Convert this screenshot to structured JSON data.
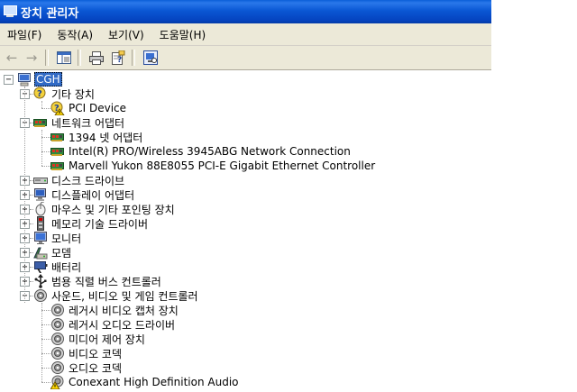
{
  "window": {
    "title": "장치 관리자"
  },
  "menu": [
    "파일(F)",
    "동작(A)",
    "보기(V)",
    "도움말(H)"
  ],
  "tree": {
    "root": "CGH",
    "categories": [
      {
        "label": "기타 장치",
        "icon": "unknown-device-icon",
        "expanded": true,
        "children": [
          {
            "label": "PCI Device",
            "icon": "warning-device-icon"
          }
        ]
      },
      {
        "label": "네트워크 어댑터",
        "icon": "network-adapter-icon",
        "expanded": true,
        "children": [
          {
            "label": "1394 넷 어댑터",
            "icon": "network-adapter-icon"
          },
          {
            "label": "Intel(R) PRO/Wireless 3945ABG Network Connection",
            "icon": "network-adapter-icon"
          },
          {
            "label": "Marvell Yukon 88E8055 PCI-E Gigabit Ethernet Controller",
            "icon": "network-adapter-icon"
          }
        ]
      },
      {
        "label": "디스크 드라이브",
        "icon": "disk-drive-icon",
        "expanded": false
      },
      {
        "label": "디스플레이 어댑터",
        "icon": "display-adapter-icon",
        "expanded": false
      },
      {
        "label": "마우스 및 기타 포인팅 장치",
        "icon": "mouse-icon",
        "expanded": false
      },
      {
        "label": "메모리 기술 드라이버",
        "icon": "memory-icon",
        "expanded": false
      },
      {
        "label": "모니터",
        "icon": "monitor-icon",
        "expanded": false
      },
      {
        "label": "모뎀",
        "icon": "modem-icon",
        "expanded": false
      },
      {
        "label": "배터리",
        "icon": "battery-icon",
        "expanded": false
      },
      {
        "label": "범용 직렬 버스 컨트롤러",
        "icon": "usb-icon",
        "expanded": false
      },
      {
        "label": "사운드, 비디오 및 게임 컨트롤러",
        "icon": "sound-icon",
        "expanded": true,
        "children": [
          {
            "label": "레거시 비디오 캡처 장치",
            "icon": "sound-icon"
          },
          {
            "label": "레거시 오디오 드라이버",
            "icon": "sound-icon"
          },
          {
            "label": "미디어 제어 장치",
            "icon": "sound-icon"
          },
          {
            "label": "비디오 코덱",
            "icon": "sound-icon"
          },
          {
            "label": "오디오 코덱",
            "icon": "sound-icon"
          },
          {
            "label": "Conexant High Definition Audio",
            "icon": "warning-sound-icon"
          }
        ]
      }
    ]
  }
}
